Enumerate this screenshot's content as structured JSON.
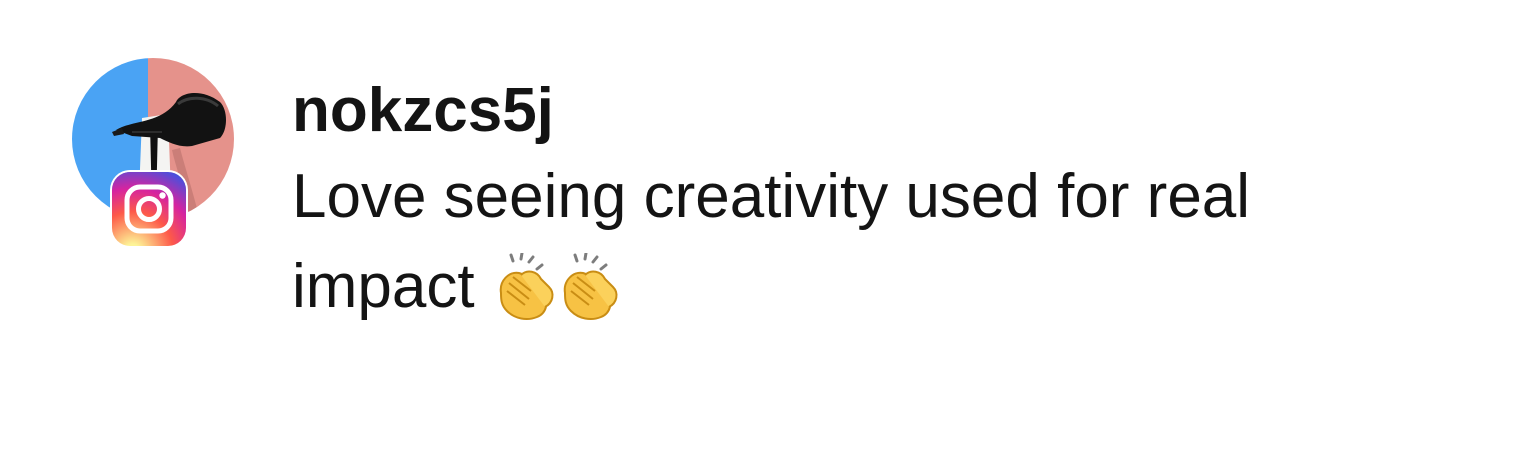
{
  "comment": {
    "author": {
      "username": "nokzcs5j",
      "avatar_icon": "high-heel-shoe-avatar",
      "platform_icon": "instagram-icon",
      "avatar_colors": {
        "left": "#4aa3f4",
        "right": "#e5928b"
      }
    },
    "text_line1": "Love seeing creativity used for real",
    "text_line2": "impact",
    "emoji": [
      "clapping-hands-icon",
      "clapping-hands-icon"
    ]
  }
}
